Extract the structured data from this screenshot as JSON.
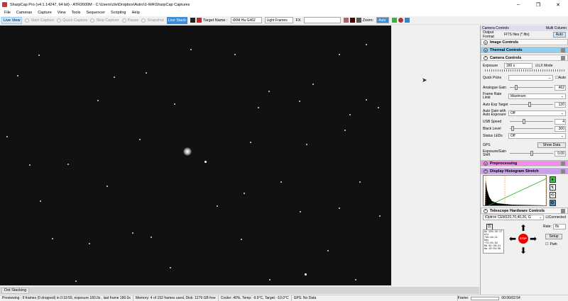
{
  "window": {
    "title": "SharpCap Pro (v4.1.14247, 64 bit) - ATR2600M - C:\\Users\\cliv\\Dropbox\\Astro\\1-WA\\SharpCap Captures"
  },
  "menu": [
    "File",
    "Cameras",
    "Capture",
    "View",
    "Tools",
    "Sequencer",
    "Scripting",
    "Help"
  ],
  "toolbar": {
    "live_view": "Live View",
    "start_capture": "Start Capture",
    "quick_capture": "Quick Capture",
    "stop_capture": "Stop Capture",
    "pause": "Pause",
    "snapshot": "Snapshot",
    "live_stack": "Live Stack",
    "target_label": "Target Name :",
    "target_value": "i00M Ha G462",
    "frame_type": "Light Frames",
    "fx_label": "FX",
    "zoom_label": "Zoom:",
    "zoom_value": "Auto"
  },
  "bottom_tab": "Dot Stacking",
  "status": {
    "preview": "Previewing : 9 frames (0 dropped) in 0:19:59, exposure 180.0s , last frame 180.0s",
    "memory": "Memory: 4 of 192 frames used, Disk: 1279 GB free",
    "cooler": "Cooler: 40%, Temp: -9.9°C, Target: -10.0°C",
    "gps": "GPS: No Data",
    "frame_label": "Frame:",
    "frame_time": "00:06/02:54"
  },
  "panel": {
    "tabs": {
      "camera_controls": "Camera Controls",
      "multi_column": "Multi Column"
    },
    "output_format_label": "Output Format",
    "output_format_value": "FITS files (*.fits)",
    "auto": "Auto",
    "sections": {
      "image_controls": "Image Controls",
      "thermal_controls": "Thermal Controls",
      "camera_controls": "Camera Controls",
      "preprocessing": "Preprocessing",
      "display_histogram": "Display Histogram Stretch",
      "telescope": "Telescope Hardware Controls"
    },
    "exposure_label": "Exposure",
    "exposure_value": "180 s",
    "lx_mode": "LX Mode",
    "quick_picks": "Quick Picks",
    "analogue_gain": "Analogue Gain",
    "analogue_gain_value": "462",
    "frame_rate_limit": "Frame Rate Limit",
    "frame_rate_value": "Maximum",
    "auto_exp_target": "Auto Exp Target",
    "auto_exp_value": "120",
    "auto_gain": "Auto Gain with Auto Exposure",
    "auto_gain_value": "Off",
    "usb_speed": "USB Speed",
    "usb_speed_value": "4",
    "black_level": "Black Level",
    "black_level_value": "300",
    "status_leds": "Status LEDs",
    "status_leds_value": "Off",
    "gps": "GPS",
    "show_data": "Show Data",
    "exposure_gain_shift": "Exposure/Gain Shift",
    "exposure_gain_shift_value": "0.00",
    "mount_name": "iOptron CEM120,70,40,26, G",
    "connected": "Connected",
    "rate_label": "Rate:",
    "rate_value": "8x",
    "setup": "Setup",
    "park": "Park",
    "stop": "STOP",
    "coords": [
      "Az  245:32:17",
      "Alt +49:19:11",
      "Dec +73:45:52",
      "RA  02:30:21",
      "Ha  10:04:06"
    ]
  },
  "colors": {
    "image_bg": "#111111",
    "live_stack": "#3a8fd8",
    "thermal": "#8fd0f5",
    "preprocessing": "#f18ee6",
    "histogram": "#c9a0ec"
  }
}
